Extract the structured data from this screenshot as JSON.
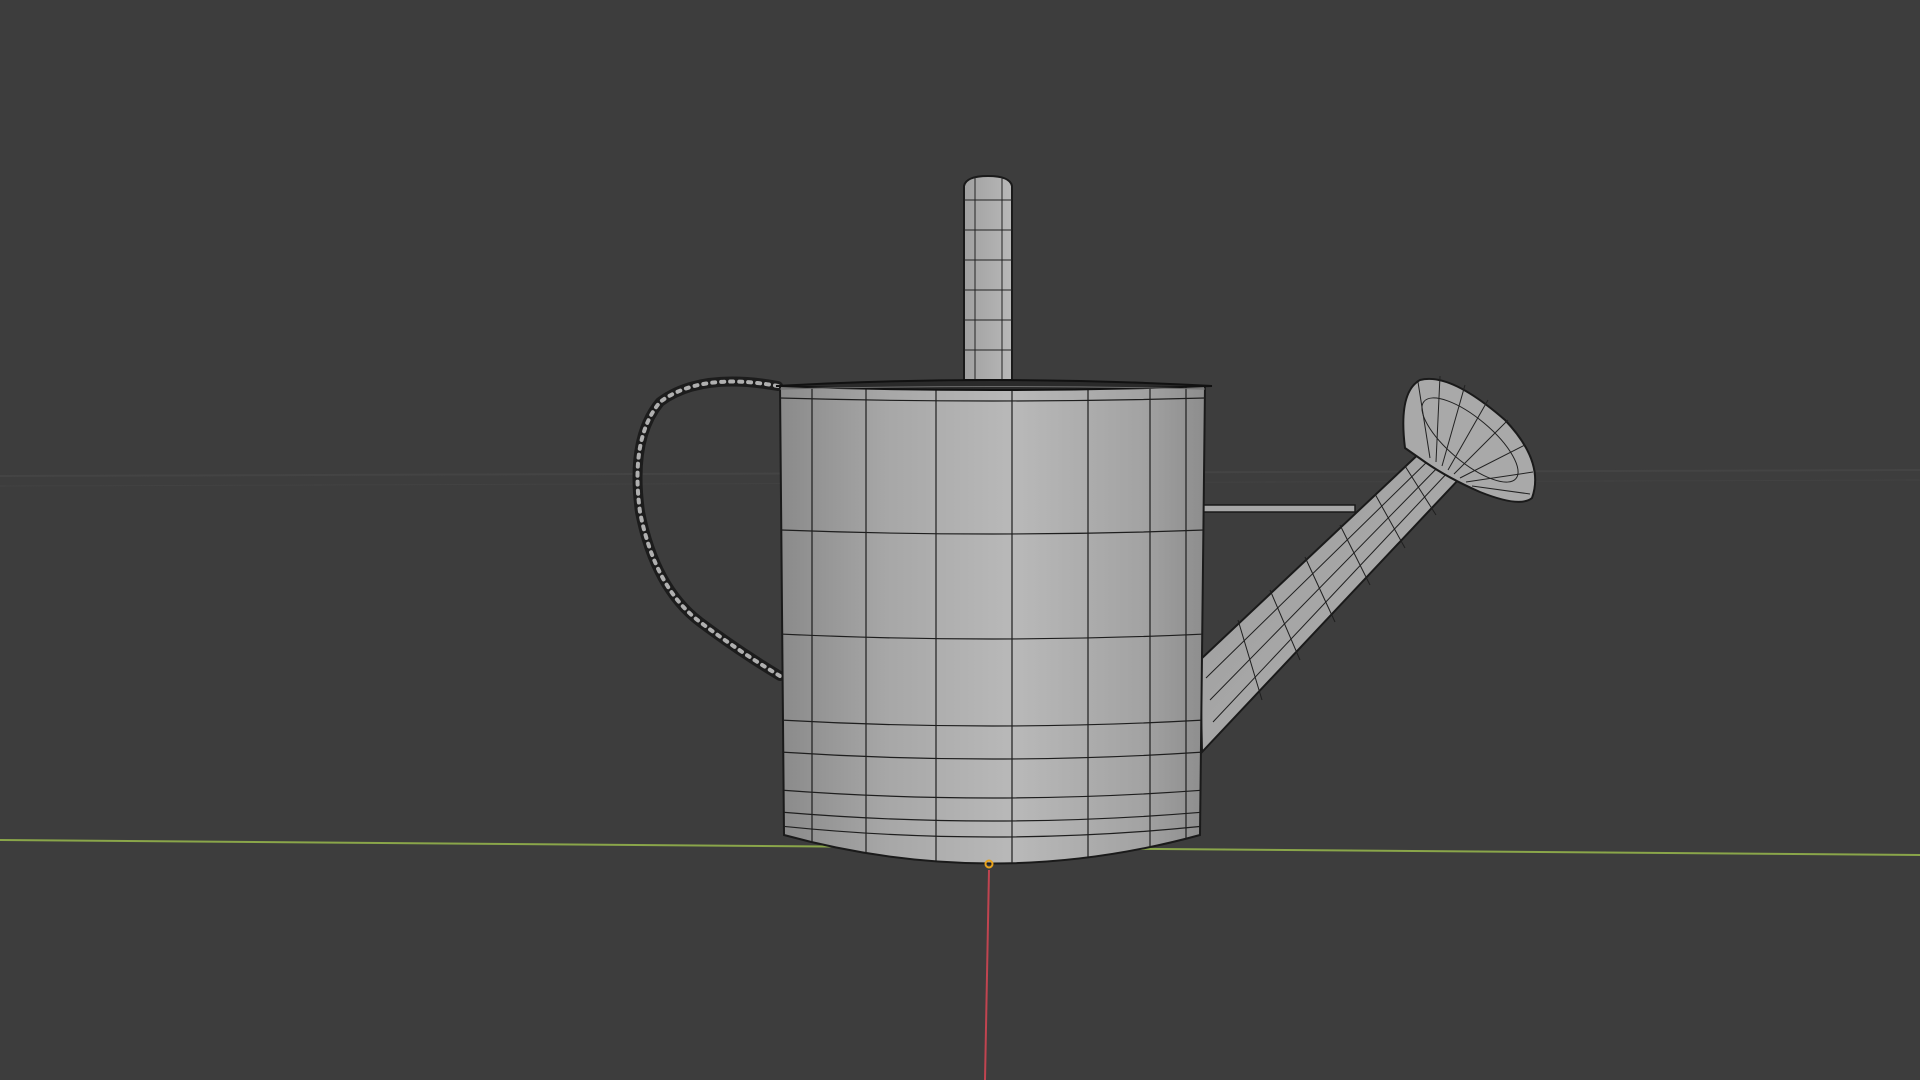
{
  "viewport": {
    "mode": "3d-viewport",
    "shading": "solid-wireframe-overlay",
    "background_color": "#3d3d3d",
    "object": "watering-can",
    "overlays": {
      "x_axis_color": "#9aba4a",
      "y_axis_color": "#c8414a",
      "origin_color": "#e8a21c"
    },
    "mesh_colors": {
      "body_fill": "#a5a5a5",
      "wire": "#161616",
      "rim": "#202020"
    }
  }
}
